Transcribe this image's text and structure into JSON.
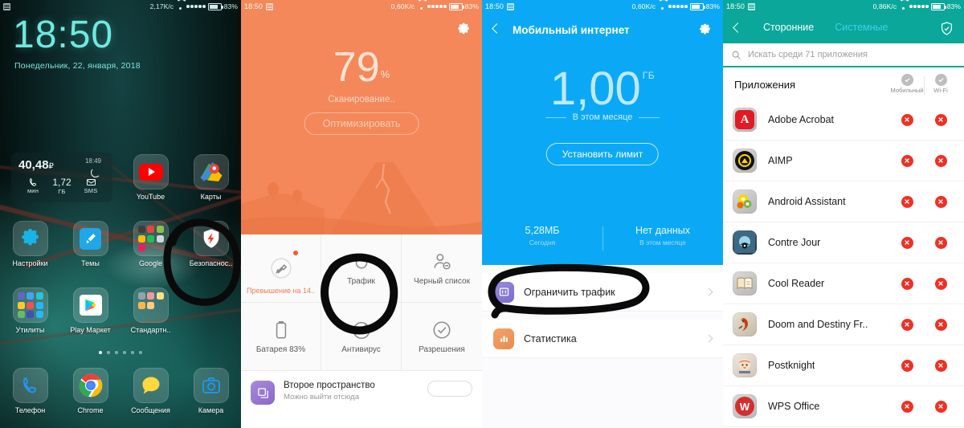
{
  "panel_home": {
    "statusbar": {
      "speed": "2,17K/c",
      "battery": "83%",
      "sim_icon": "sim-card-icon"
    },
    "clock": "18:50",
    "date": "Понедельник, 22, января, 2018",
    "widget": {
      "balance": "40,48",
      "currency": "₽",
      "time": "18:49",
      "refresh_icon": "refresh-icon",
      "cells": [
        {
          "icon": "phone-icon",
          "value": "",
          "key": "мин"
        },
        {
          "icon": "",
          "value": "1,72",
          "key": "ГБ"
        },
        {
          "icon": "mail-icon",
          "value": "",
          "key": "SMS"
        }
      ]
    },
    "rows": [
      [
        {
          "label": "YouTube",
          "icon": "youtube-icon"
        },
        {
          "label": "Карты",
          "icon": "google-maps-icon"
        }
      ],
      [
        {
          "label": "Настройки",
          "icon": "settings-gear-icon"
        },
        {
          "label": "Темы",
          "icon": "themes-icon"
        },
        {
          "label": "Google",
          "icon": "folder-icon"
        },
        {
          "label": "Безопаснос..",
          "icon": "security-shield-icon"
        }
      ],
      [
        {
          "label": "Утилиты",
          "icon": "folder-icon"
        },
        {
          "label": "Play Маркет",
          "icon": "play-store-icon"
        },
        {
          "label": "Стандартн..",
          "icon": "folder-icon"
        }
      ]
    ],
    "dock": [
      {
        "label": "Телефон",
        "icon": "phone-icon"
      },
      {
        "label": "Chrome",
        "icon": "chrome-icon"
      },
      {
        "label": "Сообщения",
        "icon": "messages-icon"
      },
      {
        "label": "Камера",
        "icon": "camera-icon"
      }
    ],
    "page_dots": 6,
    "page_active": 0,
    "annotation": "circle-around-security-app"
  },
  "panel_security": {
    "statusbar": {
      "time": "18:50",
      "speed": "0,60K/c",
      "battery": "83%"
    },
    "gear_icon": "gear-icon",
    "percent": "79",
    "percent_unit": "%",
    "scan_status": "Сканирование..",
    "optimize_button": "Оптимизировать",
    "tiles": [
      {
        "label": "",
        "icon": "broom-cleaner-icon",
        "warning": "Превышение на 14..",
        "badge": true
      },
      {
        "label": "Трафик",
        "icon": "water-drop-icon",
        "warning": "",
        "badge": false
      },
      {
        "label": "Черный список",
        "icon": "blocked-user-icon",
        "warning": "",
        "badge": false
      },
      {
        "label": "Батарея 83%",
        "icon": "battery-icon",
        "warning": "",
        "badge": false
      },
      {
        "label": "Антивирус",
        "icon": "antivirus-clock-icon",
        "warning": "",
        "badge": false
      },
      {
        "label": "Разрешения",
        "icon": "check-circle-icon",
        "warning": "",
        "badge": false
      }
    ],
    "card": {
      "title": "Второе пространство",
      "subtitle": "Можно выйти отсюда",
      "icon": "second-space-icon"
    },
    "annotation": "circle-around-traffic-tile"
  },
  "panel_internet": {
    "statusbar": {
      "time": "18:50",
      "speed": "0,60K/c",
      "battery": "83%"
    },
    "title": "Мобильный интернет",
    "back_icon": "back-arrow-icon",
    "gear_icon": "gear-icon",
    "amount": "1,00",
    "unit": "ГБ",
    "period": "В этом месяце",
    "limit_button": "Установить лимит",
    "stats": [
      {
        "value": "5,28МБ",
        "key": "Сегодня"
      },
      {
        "value": "Нет данных",
        "key": "В этом месяце"
      }
    ],
    "rows": [
      {
        "label": "Ограничить трафик",
        "icon": "restrict-traffic-icon",
        "chevron": "chevron-right-icon"
      },
      {
        "label": "Статистика",
        "icon": "statistics-bars-icon",
        "chevron": "chevron-right-icon"
      }
    ],
    "annotation": "circle-around-restrict-traffic-row"
  },
  "panel_apps": {
    "statusbar": {
      "time": "18:50",
      "speed": "0,86K/c",
      "battery": "83%"
    },
    "back_icon": "back-arrow-icon",
    "tabs": [
      {
        "label": "Сторонние",
        "active": true
      },
      {
        "label": "Системные",
        "active": false
      }
    ],
    "shield_icon": "shield-check-icon",
    "search": {
      "placeholder": "Искать среди 71 приложения",
      "icon": "search-icon",
      "value": ""
    },
    "list_title": "Приложения",
    "columns": [
      {
        "label": "Мобильный",
        "icon": "check-circle-icon"
      },
      {
        "label": "Wi-Fi",
        "icon": "check-circle-icon"
      }
    ],
    "apps": [
      {
        "name": "Adobe Acrobat",
        "icon": "adobe-acrobat-icon",
        "mobile": "blocked",
        "wifi": "blocked"
      },
      {
        "name": "AIMP",
        "icon": "aimp-icon",
        "mobile": "blocked",
        "wifi": "blocked"
      },
      {
        "name": "Android Assistant",
        "icon": "android-assistant-icon",
        "mobile": "blocked",
        "wifi": "blocked"
      },
      {
        "name": "Contre Jour",
        "icon": "contre-jour-icon",
        "mobile": "blocked",
        "wifi": "blocked"
      },
      {
        "name": "Cool Reader",
        "icon": "cool-reader-icon",
        "mobile": "blocked",
        "wifi": "blocked"
      },
      {
        "name": "Doom and Destiny Fr..",
        "icon": "doom-destiny-icon",
        "mobile": "blocked",
        "wifi": "blocked"
      },
      {
        "name": "Postknight",
        "icon": "postknight-icon",
        "mobile": "blocked",
        "wifi": "blocked"
      },
      {
        "name": "WPS Office",
        "icon": "wps-office-icon",
        "mobile": "blocked",
        "wifi": "blocked"
      }
    ]
  },
  "colors": {
    "home_accent": "#6fe9e0",
    "security_orange": "#f4885a",
    "internet_blue": "#0ba9f5",
    "apps_teal": "#0aa79a",
    "block_red": "#ee3124",
    "annotation_black": "#0a0a0a"
  }
}
